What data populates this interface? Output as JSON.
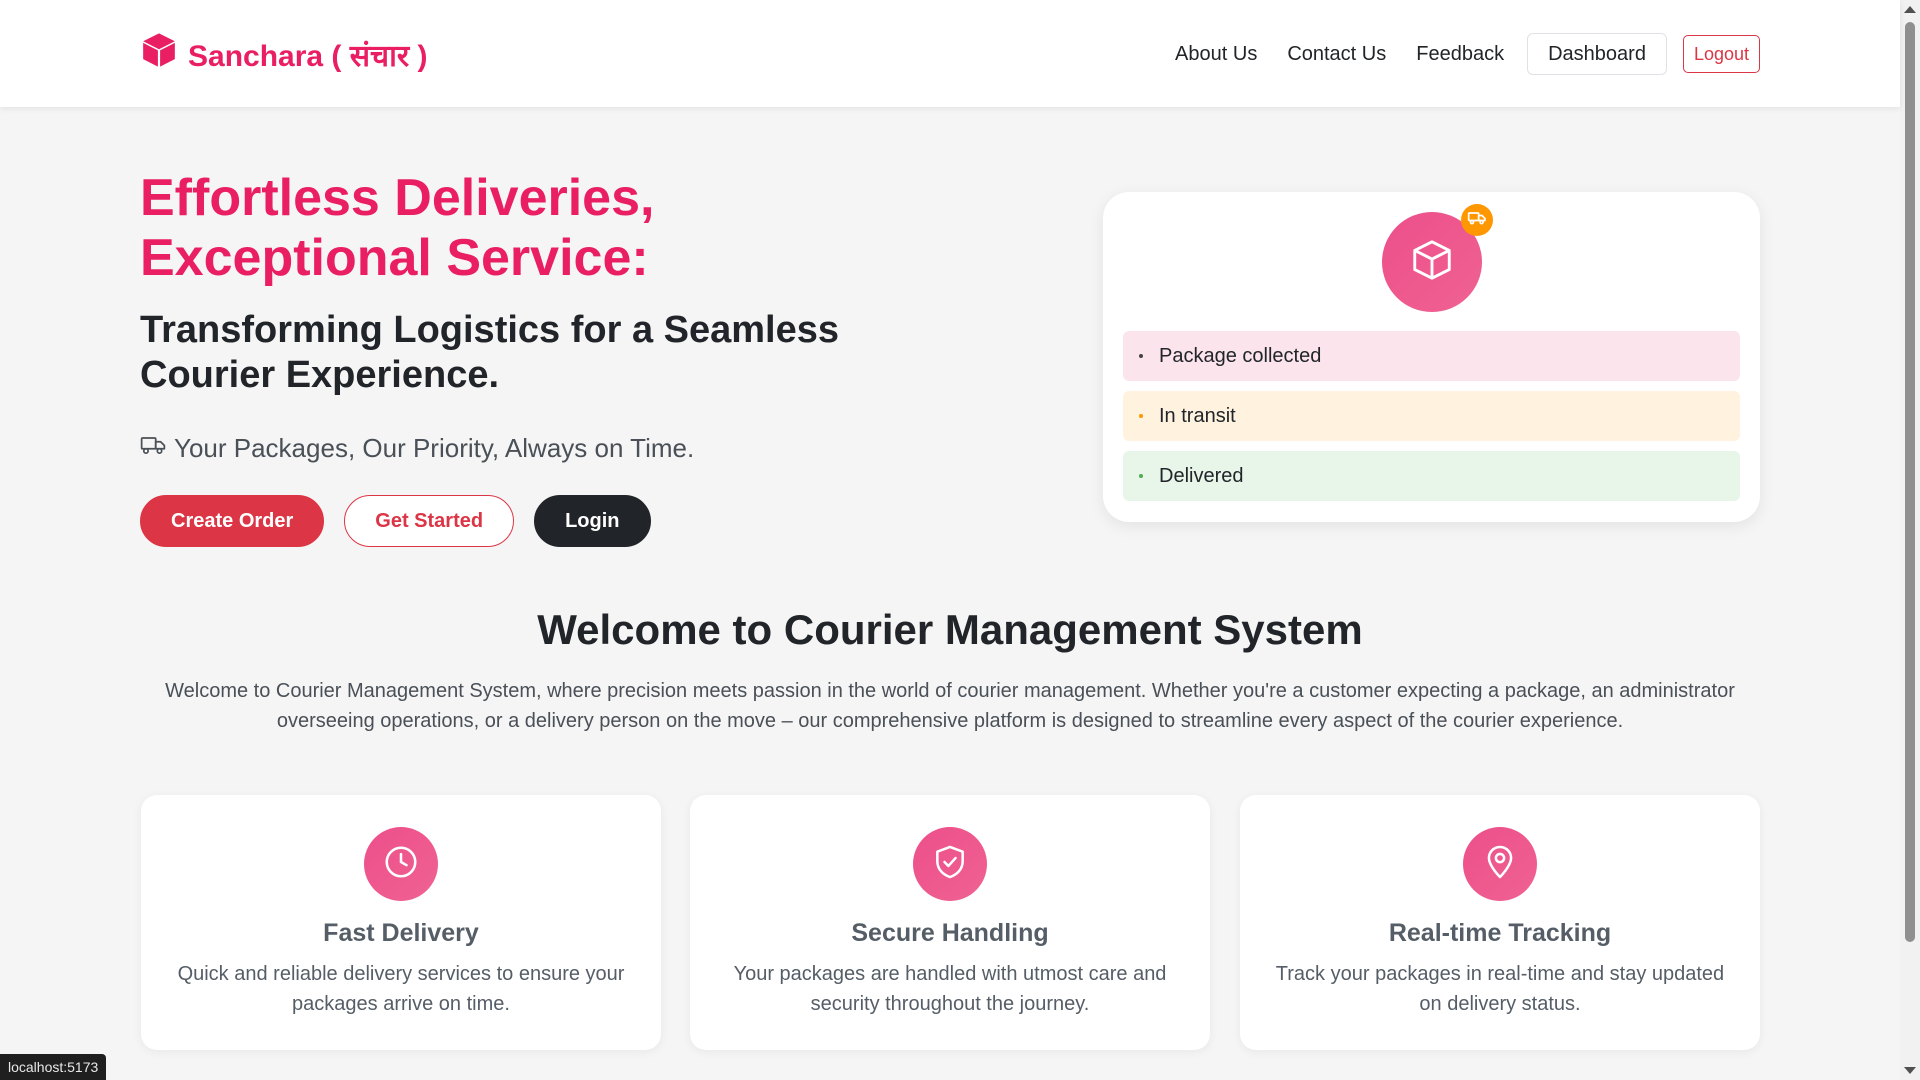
{
  "brand": {
    "name": "Sanchara ( संचार )",
    "icon": "box-icon",
    "color": "#e91e63"
  },
  "nav": {
    "links": [
      "About Us",
      "Contact Us",
      "Feedback"
    ],
    "dashboard_label": "Dashboard",
    "logout_label": "Logout"
  },
  "hero": {
    "title": "Effortless Deliveries, Exceptional Service:",
    "subtitle": "Transforming Logistics for a Seamless Courier Experience.",
    "tagline": "Your Packages, Our Priority, Always on Time.",
    "tagline_icon": "truck-icon",
    "buttons": {
      "create_order": "Create Order",
      "get_started": "Get Started",
      "login": "Login"
    }
  },
  "status_card": {
    "icon": "box-icon",
    "badge_icon": "truck-icon",
    "items": [
      "Package collected",
      "In transit",
      "Delivered"
    ]
  },
  "welcome": {
    "title": "Welcome to Courier Management System",
    "text": "Welcome to Courier Management System, where precision meets passion in the world of courier management. Whether you're a customer expecting a package, an administrator overseeing operations, or a delivery person on the move – our comprehensive platform is designed to streamline every aspect of the courier experience."
  },
  "features": [
    {
      "icon": "clock-icon",
      "title": "Fast Delivery",
      "desc": "Quick and reliable delivery services to ensure your packages arrive on time."
    },
    {
      "icon": "shield-check-icon",
      "title": "Secure Handling",
      "desc": "Your packages are handled with utmost care and security throughout the journey."
    },
    {
      "icon": "location-pin-icon",
      "title": "Real-time Tracking",
      "desc": "Track your packages in real-time and stay updated on delivery status."
    }
  ],
  "status_bar": {
    "url": "localhost:5173"
  },
  "colors": {
    "accent": "#e91e63",
    "danger": "#dc3545",
    "dark": "#212529",
    "orange": "#ff9800"
  }
}
